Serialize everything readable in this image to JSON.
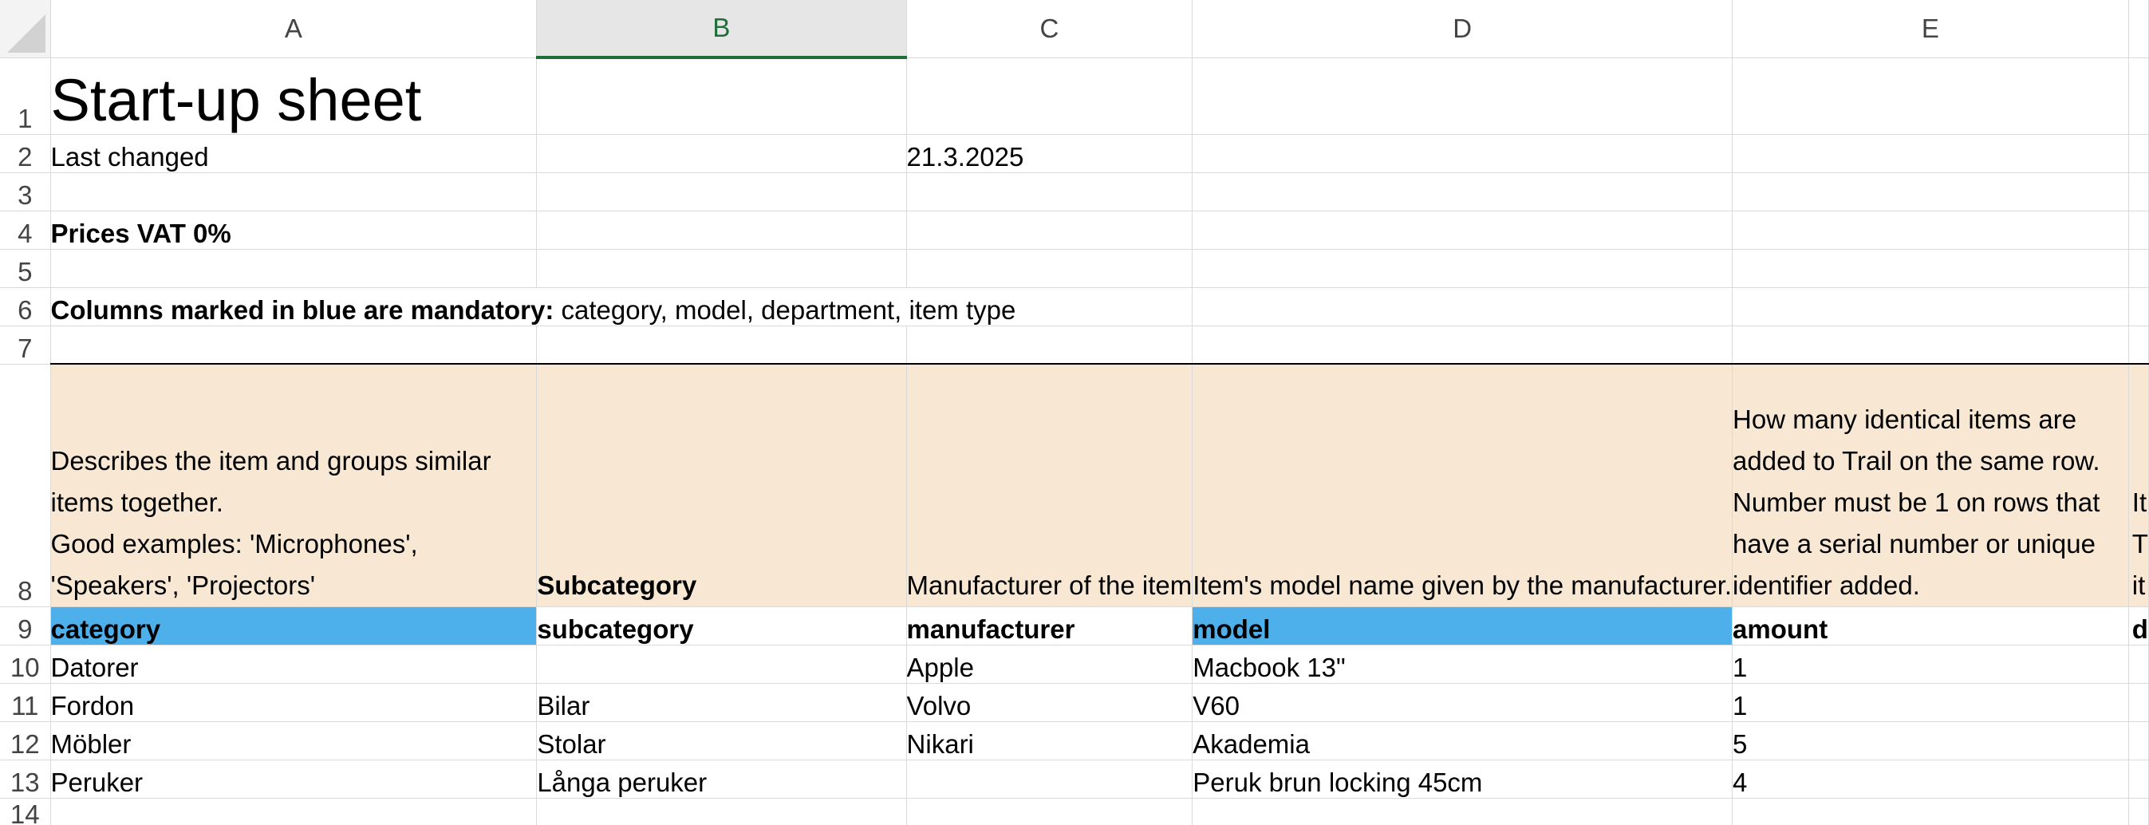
{
  "columns": [
    "A",
    "B",
    "C",
    "D",
    "E"
  ],
  "rows": [
    "1",
    "2",
    "3",
    "4",
    "5",
    "6",
    "7",
    "8",
    "9",
    "10",
    "11",
    "12",
    "13",
    "14"
  ],
  "title": "Start-up sheet",
  "last_changed": {
    "label": "Last changed",
    "date": "21.3.2025"
  },
  "prices_note": "Prices VAT 0%",
  "mandatory_note": {
    "bold": "Columns marked in blue are mandatory:",
    "rest": " category, model, department, item type"
  },
  "descriptions": {
    "category": "Describes the item and groups similar items together.\nGood examples: 'Microphones', 'Speakers', 'Projectors'",
    "subcategory": "Subcategory",
    "manufacturer": "Manufacturer of the item",
    "model": "Item's model name given by the manufacturer.",
    "amount": "How many identical items are added to Trail on the same row.\nNumber must be 1 on rows that have a serial number or unique identifier added.",
    "next_partial": "It\nT\nit"
  },
  "fields": [
    "category",
    "subcategory",
    "manufacturer",
    "model",
    "amount",
    "d"
  ],
  "data_rows": [
    [
      "Datorer",
      "",
      "Apple",
      "Macbook 13\"",
      "1"
    ],
    [
      "Fordon",
      "Bilar",
      "Volvo",
      "V60",
      "1"
    ],
    [
      "Möbler",
      "Stolar",
      "Nikari",
      "Akademia",
      "5"
    ],
    [
      "Peruker",
      "Långa peruker",
      "",
      "Peruk brun locking 45cm",
      "4"
    ]
  ],
  "colors": {
    "mandatory": "#4eb0ea",
    "description_fill": "#f7e7d3",
    "selected_col": "#1e6e3a"
  }
}
